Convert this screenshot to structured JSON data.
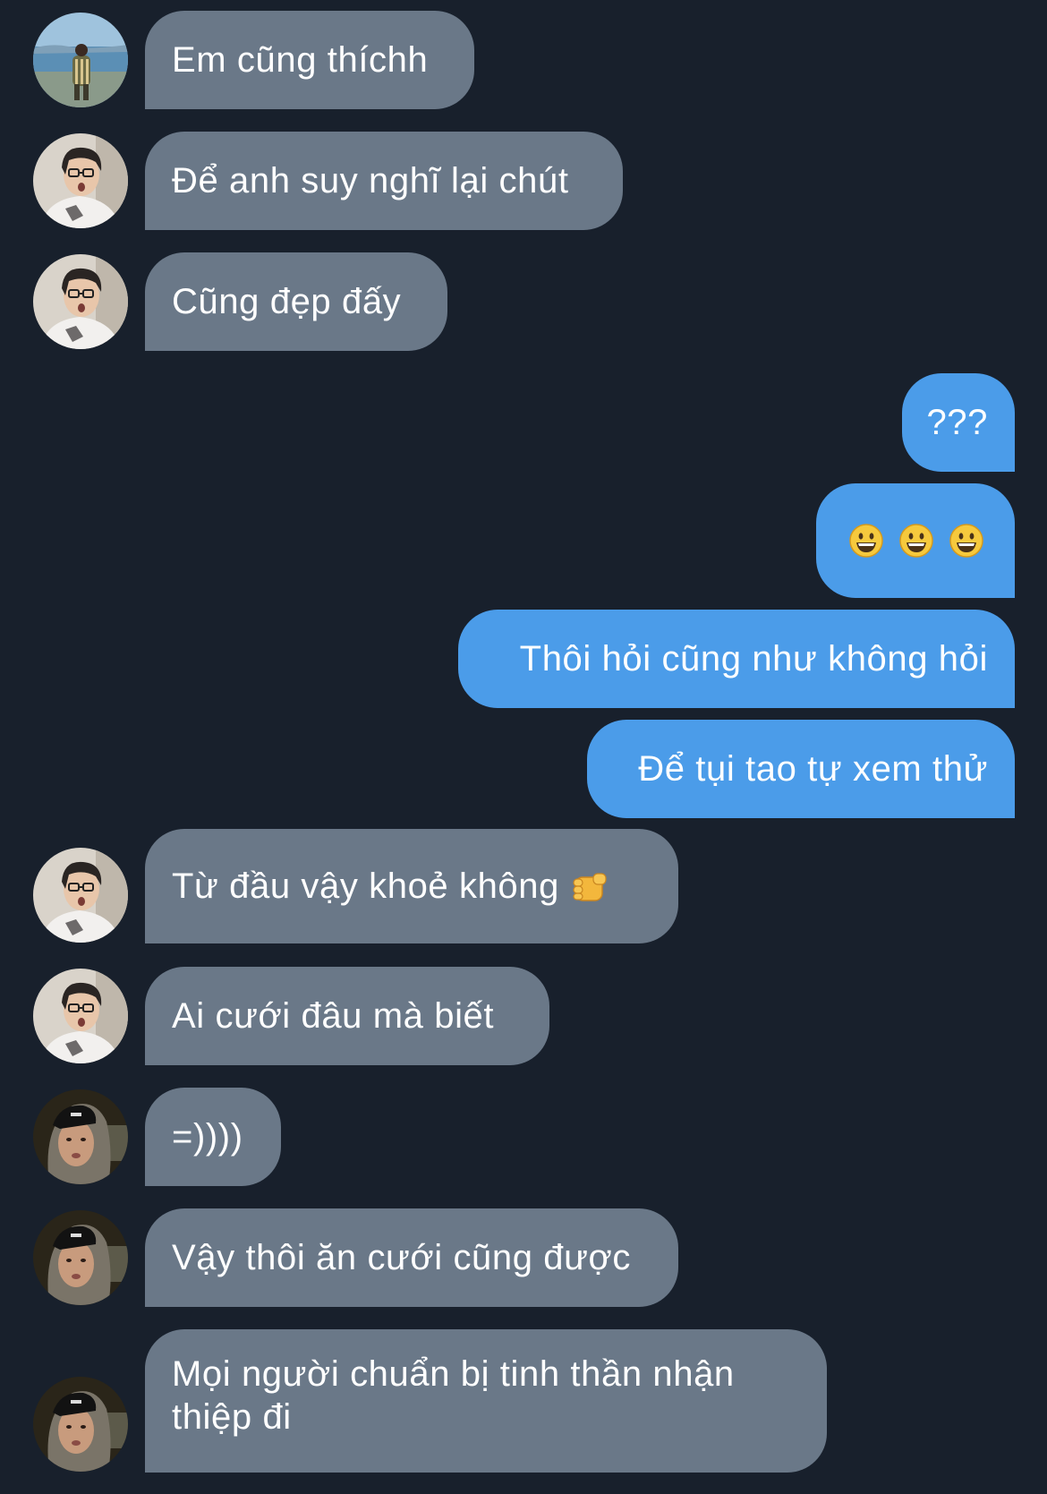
{
  "theme": {
    "background": "#18202c",
    "incoming_bubble": "#6a7888",
    "outgoing_bubble": "#4b9ce9",
    "text": "#ffffff"
  },
  "messages": [
    {
      "direction": "incoming",
      "avatar": "beach-photo-avatar",
      "text": "Em cũng thíchh"
    },
    {
      "direction": "incoming",
      "avatar": "glasses-person-avatar",
      "text": "Để anh suy nghĩ lại chút"
    },
    {
      "direction": "incoming",
      "avatar": "glasses-person-avatar",
      "text": "Cũng đẹp đấy"
    },
    {
      "direction": "outgoing",
      "text": "???"
    },
    {
      "direction": "outgoing",
      "emoji": [
        "grinning-face-icon",
        "grinning-face-icon",
        "grinning-face-icon"
      ]
    },
    {
      "direction": "outgoing",
      "text": "Thôi hỏi cũng như không hỏi"
    },
    {
      "direction": "outgoing",
      "text": "Để tụi tao tự xem thử"
    },
    {
      "direction": "incoming",
      "avatar": "glasses-person-avatar",
      "text": "Từ đầu vậy khoẻ không",
      "trailing_emoji": "fist-icon"
    },
    {
      "direction": "incoming",
      "avatar": "glasses-person-avatar",
      "text": "Ai cưới đâu mà biết"
    },
    {
      "direction": "incoming",
      "avatar": "hooded-person-avatar",
      "text": "=))))"
    },
    {
      "direction": "incoming",
      "avatar": "hooded-person-avatar",
      "text": "Vậy thôi ăn cưới cũng được"
    },
    {
      "direction": "incoming",
      "avatar": "hooded-person-avatar",
      "text_lines": [
        "Mọi người chuẩn bị tinh thần nhận",
        "thiệp đi"
      ]
    }
  ]
}
